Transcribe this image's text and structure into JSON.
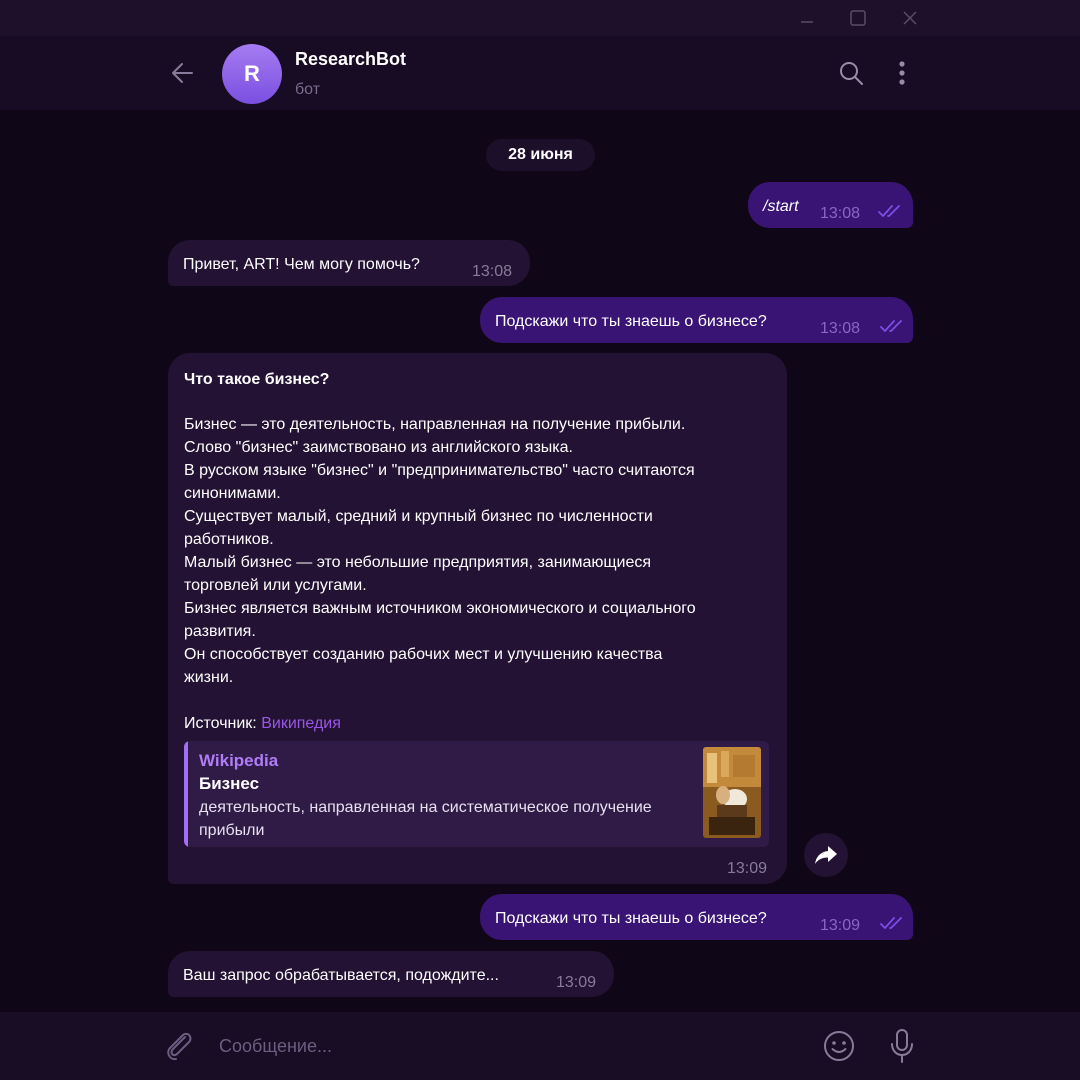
{
  "window": {
    "minimize_icon": "minimize-icon",
    "maximize_icon": "maximize-icon",
    "close_icon": "close-icon"
  },
  "header": {
    "avatar_letter": "R",
    "name": "ResearchBot",
    "status": "бот",
    "back_icon": "arrow-left-icon",
    "search_icon": "search-icon",
    "menu_icon": "more-vertical-icon"
  },
  "date_divider": "28 июня",
  "messages": [
    {
      "direction": "out",
      "text": "/start",
      "time": "13:08",
      "status": "read"
    },
    {
      "direction": "in",
      "text": "Привет, ART! Чем могу помочь?",
      "time": "13:08"
    },
    {
      "direction": "out",
      "text": "Подскажи что ты знаешь о бизнесе?",
      "time": "13:08",
      "status": "read"
    },
    {
      "direction": "in",
      "title": "Что такое бизнес?",
      "lines": [
        "Бизнес — это деятельность, направленная на получение прибыли.",
        "Слово \"бизнес\" заимствовано из английского языка.",
        "В русском языке \"бизнес\" и \"предпринимательство\" часто считаются",
        "синонимами.",
        "Существует малый, средний и крупный бизнес по численности",
        "работников.",
        "Малый бизнес — это небольшие предприятия, занимающиеся",
        "торговлей или услугами.",
        "Бизнес является важным источником экономического и социального",
        "развития.",
        "Он способствует созданию рабочих мест и улучшению качества",
        "жизни."
      ],
      "source_label": "Источник:",
      "source_link": "Википедия",
      "preview": {
        "site": "Wikipedia",
        "title": "Бизнес",
        "description": "деятельность, направленная на систематическое получение прибыли"
      },
      "time": "13:09"
    },
    {
      "direction": "out",
      "text": "Подскажи что ты знаешь о бизнесе?",
      "time": "13:09",
      "status": "read"
    },
    {
      "direction": "in",
      "text": "Ваш запрос обрабатывается, подождите...",
      "time": "13:09"
    }
  ],
  "forward_icon": "forward-arrow-icon",
  "composer": {
    "placeholder": "Сообщение...",
    "value": "",
    "attach_icon": "paperclip-icon",
    "emoji_icon": "smiley-icon",
    "mic_icon": "microphone-icon"
  },
  "colors": {
    "background": "#0f0718",
    "outgoing_bubble": "#3a1474",
    "incoming_bubble": "#231233",
    "accent": "#9a56e6",
    "read_checks": "#7c4ee6"
  }
}
